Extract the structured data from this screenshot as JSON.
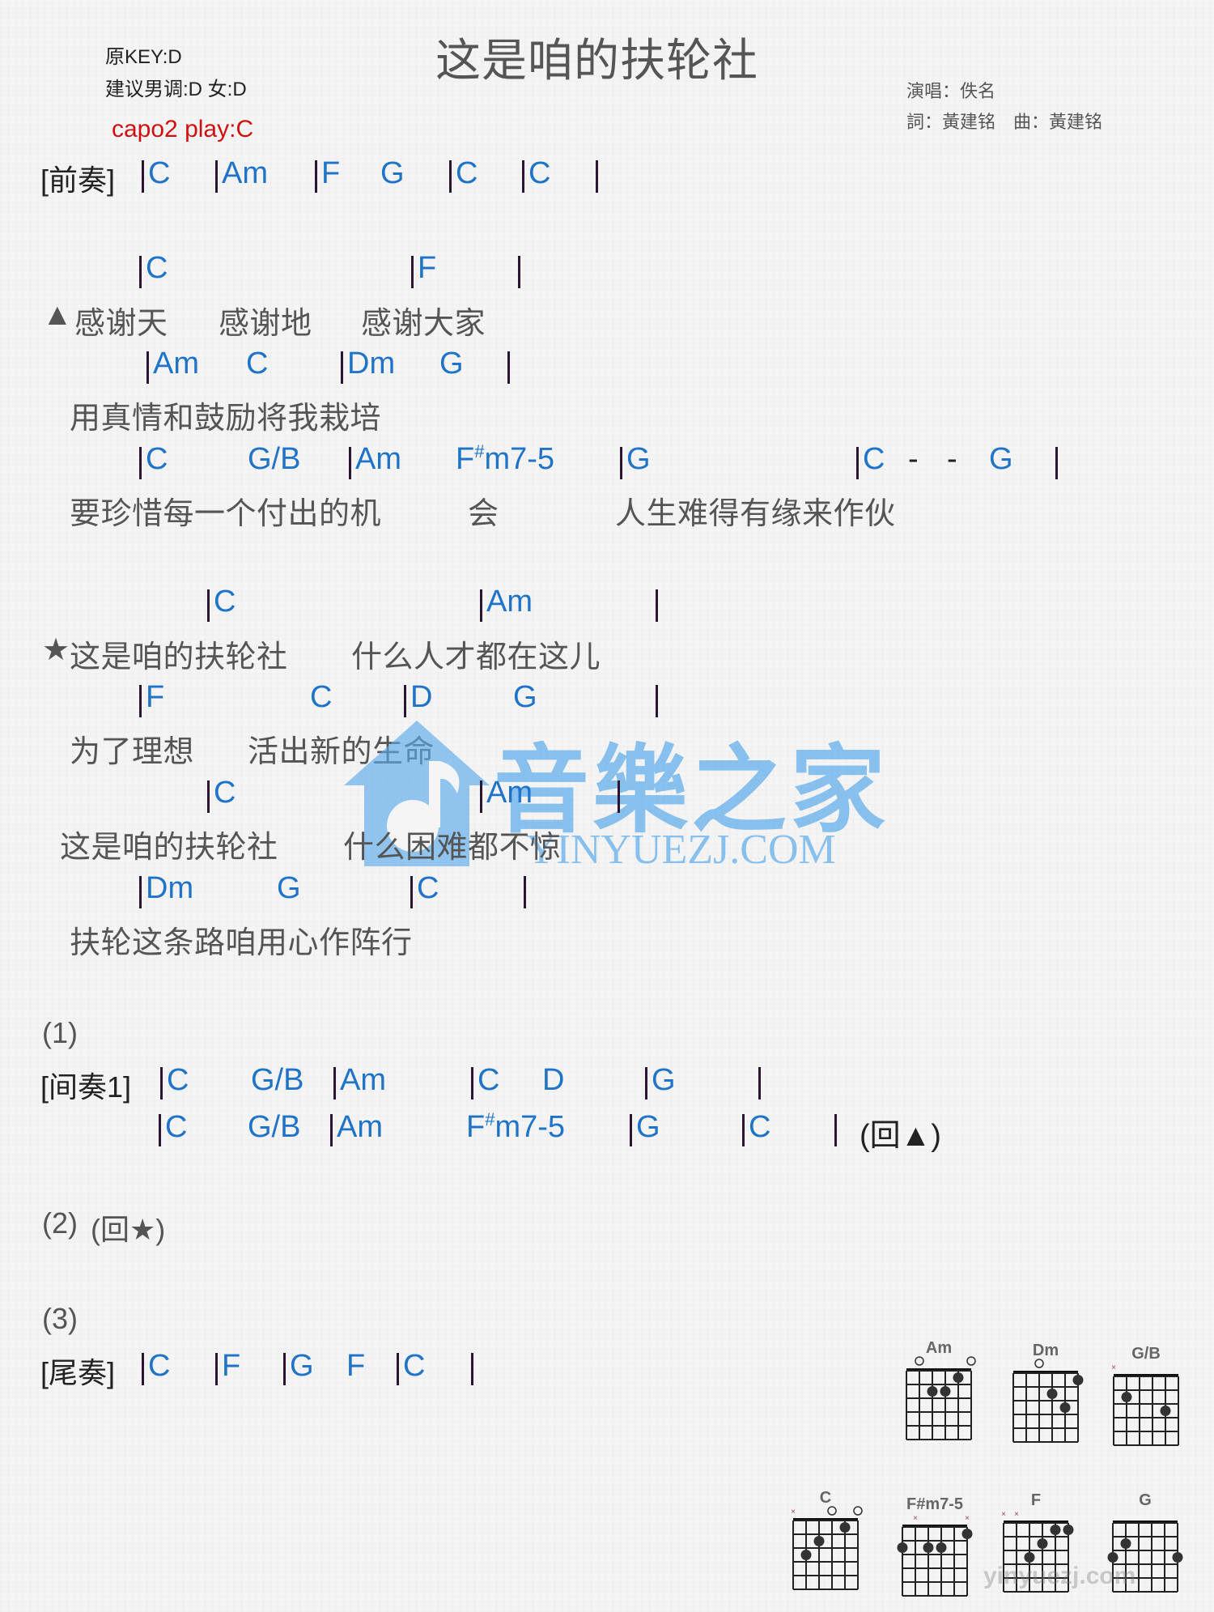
{
  "header": {
    "title": "这是咱的扶轮社",
    "original_key": "原KEY:D",
    "suggested_key": "建议男调:D 女:D",
    "capo": "capo2 play:C",
    "singer": "演唱：佚名",
    "credits": "詞：黃建铭　曲：黃建铭"
  },
  "intro": {
    "label": "[前奏]",
    "chords": [
      "C",
      "Am",
      "F",
      "G",
      "C",
      "C"
    ]
  },
  "verse": {
    "marker": "▲",
    "lines": [
      {
        "chords": [
          "C",
          "F"
        ],
        "lyric_parts": [
          "感谢天",
          "感谢地",
          "感谢大家"
        ]
      },
      {
        "chords": [
          "Am",
          "C",
          "Dm",
          "G"
        ],
        "lyric": "用真情和鼓励将我栽培"
      },
      {
        "chords": [
          "C",
          "G/B",
          "Am",
          "F",
          "m7-5",
          "G",
          "C",
          "G"
        ],
        "lyric_parts": [
          "要珍惜每一个付出的机",
          "会",
          "人生难得有缘来作伙"
        ],
        "sharp": "#",
        "dash": "-"
      }
    ]
  },
  "chorus": {
    "marker": "★",
    "lines": [
      {
        "chords": [
          "C",
          "Am"
        ],
        "lyric_parts": [
          "这是咱的扶轮社",
          "什么人才都在这儿"
        ]
      },
      {
        "chords": [
          "F",
          "C",
          "D",
          "G"
        ],
        "lyric_parts": [
          "为了理想",
          "活出新的生命"
        ]
      },
      {
        "chords": [
          "C",
          "Am"
        ],
        "lyric_parts": [
          "这是咱的扶轮社",
          "什么困难都不惊"
        ]
      },
      {
        "chords": [
          "Dm",
          "G",
          "C"
        ],
        "lyric": "扶轮这条路咱用心作阵行"
      }
    ]
  },
  "section1": {
    "number": "(1)",
    "label": "[间奏1]",
    "row1": [
      "C",
      "G/B",
      "Am",
      "C",
      "D",
      "G"
    ],
    "row2": [
      "C",
      "G/B",
      "Am",
      "F",
      "m7-5",
      "G",
      "C"
    ],
    "return": "(回▲)"
  },
  "section2": {
    "number": "(2)",
    "return": "(回★)"
  },
  "section3": {
    "number": "(3)",
    "label": "[尾奏]",
    "chords": [
      "C",
      "F",
      "G",
      "F",
      "C"
    ]
  },
  "chord_diagrams": [
    {
      "name": "Am",
      "mute": [],
      "open": [
        1,
        5
      ]
    },
    {
      "name": "Dm",
      "mute": [],
      "open": [
        2
      ]
    },
    {
      "name": "G/B",
      "mute": [
        0
      ],
      "open": []
    },
    {
      "name": "C",
      "mute": [
        0
      ],
      "open": [
        3,
        5
      ]
    },
    {
      "name": "F#m7-5",
      "mute": [
        1,
        5
      ],
      "open": []
    },
    {
      "name": "F",
      "mute": [
        0,
        1
      ],
      "open": []
    },
    {
      "name": "G",
      "mute": [],
      "open": []
    }
  ],
  "watermark": {
    "brand": "音樂之家",
    "domain": "YINYUEZJ.COM",
    "domain_small": "yinyuezj.com"
  }
}
